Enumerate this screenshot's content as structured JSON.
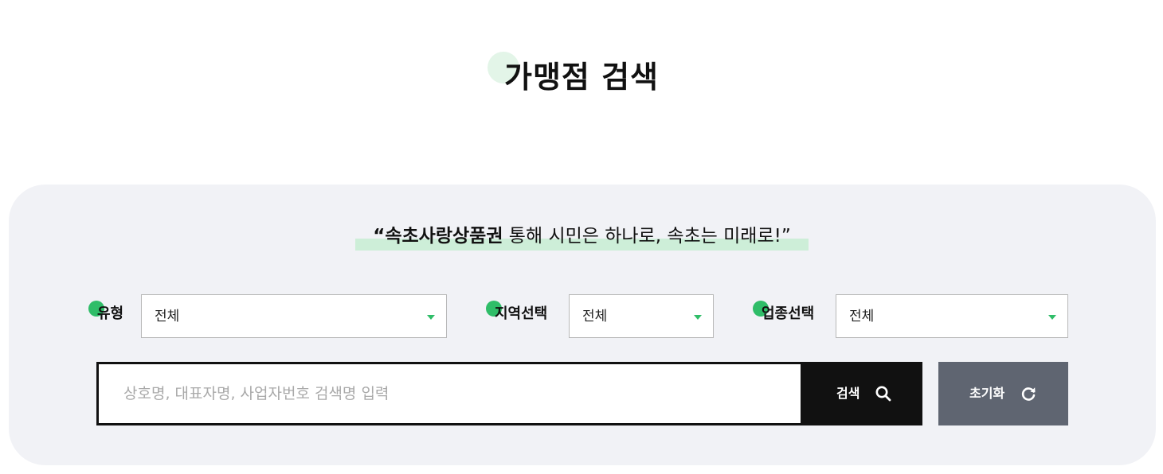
{
  "page": {
    "title": "가맹점 검색"
  },
  "slogan": {
    "bold": "“속초사랑상품권",
    "rest": " 통해 시민은 하나로, 속초는 미래로!”"
  },
  "filters": {
    "type": {
      "label": "유형",
      "value": "전체"
    },
    "region": {
      "label": "지역선택",
      "value": "전체"
    },
    "industry": {
      "label": "업종선택",
      "value": "전체"
    }
  },
  "search": {
    "placeholder": "상호명, 대표자명, 사업자번호 검색명 입력",
    "value": "",
    "button_label": "검색",
    "reset_label": "초기화"
  },
  "icons": {
    "search": "search-icon",
    "reset": "refresh-icon",
    "caret": "caret-down-icon"
  },
  "colors": {
    "accent": "#2fbd68",
    "highlight": "#cdeed8",
    "panel": "#f1f2f6",
    "search_button": "#111111",
    "reset_button": "#5f6571"
  }
}
